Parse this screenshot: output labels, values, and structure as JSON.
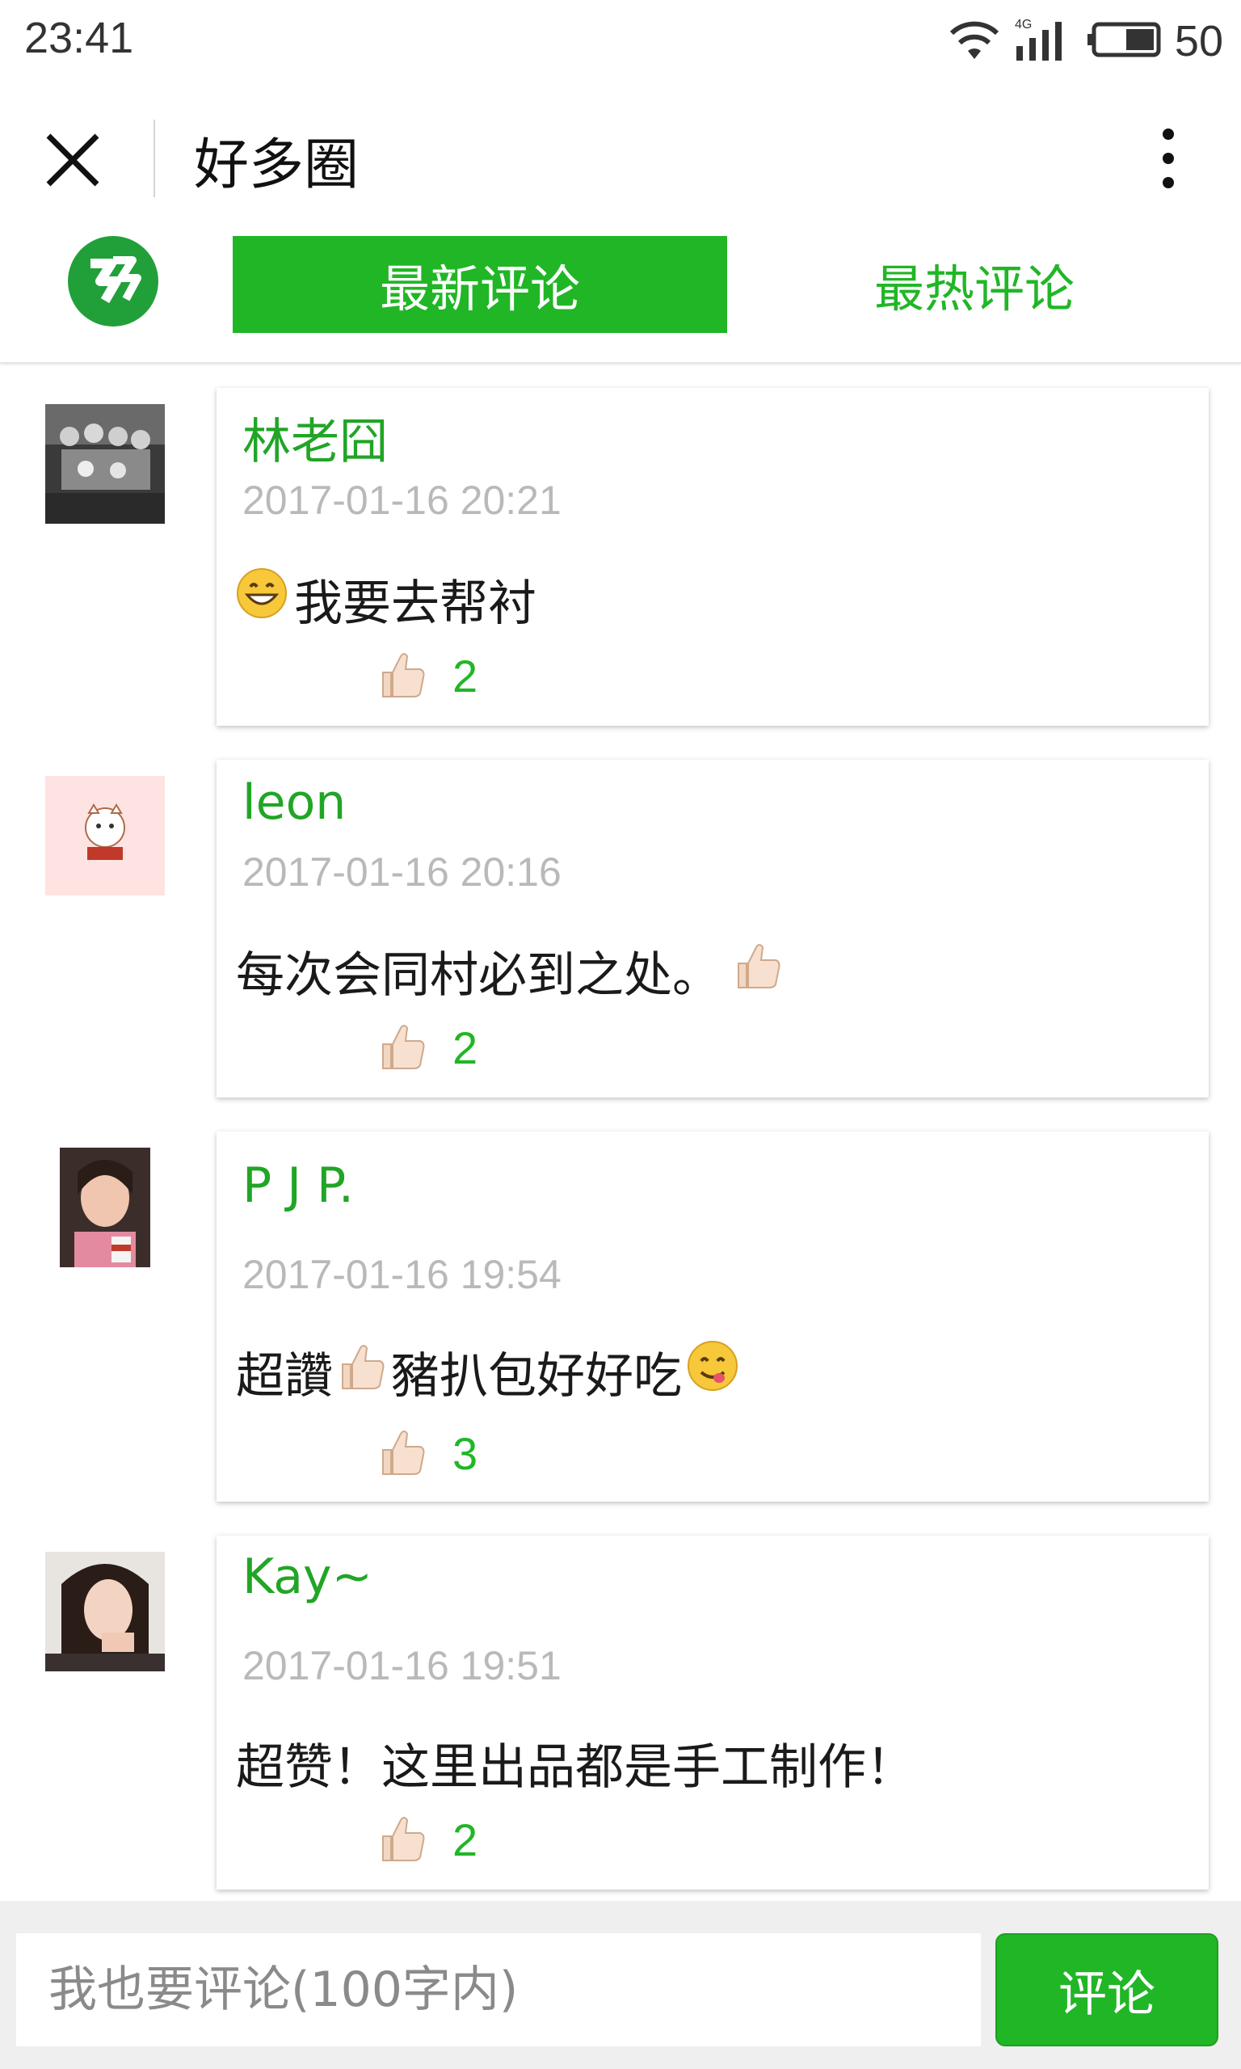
{
  "status_bar": {
    "time": "23:41",
    "network": "4G",
    "battery": "50",
    "icons": [
      "wifi-icon",
      "signal-icon",
      "battery-icon"
    ]
  },
  "title_bar": {
    "title": "好多圈",
    "close_icon": "close-icon",
    "more_icon": "more-vertical-icon"
  },
  "tabs": [
    {
      "label": "最新评论",
      "active": true
    },
    {
      "label": "最热评论",
      "active": false
    }
  ],
  "logo_icon": "app-logo-icon",
  "accent_color": "#21b626",
  "comments": [
    {
      "username": "林老囧",
      "time": "2017-01-16 20:21",
      "text": "我要去帮衬",
      "prefix_emoji": "grin-emoji-icon",
      "suffix_emoji": "",
      "likes": "2"
    },
    {
      "username": "leon",
      "time": "2017-01-16 20:16",
      "text": "每次会同村必到之处。",
      "prefix_emoji": "",
      "suffix_emoji": "thumbs-up-emoji-icon",
      "likes": "2"
    },
    {
      "username": "P J P.",
      "time": "2017-01-16 19:54",
      "text_a": "超讚",
      "text_b": "豬扒包好好吃",
      "mid_emoji": "thumbs-up-emoji-icon",
      "suffix_emoji": "yum-emoji-icon",
      "likes": "3"
    },
    {
      "username": "Kay~",
      "time": "2017-01-16 19:51",
      "text": "超赞！这里出品都是手工制作！",
      "likes": "2"
    }
  ],
  "comment_box": {
    "placeholder": "我也要评论(100字内)",
    "button_label": "评论"
  }
}
